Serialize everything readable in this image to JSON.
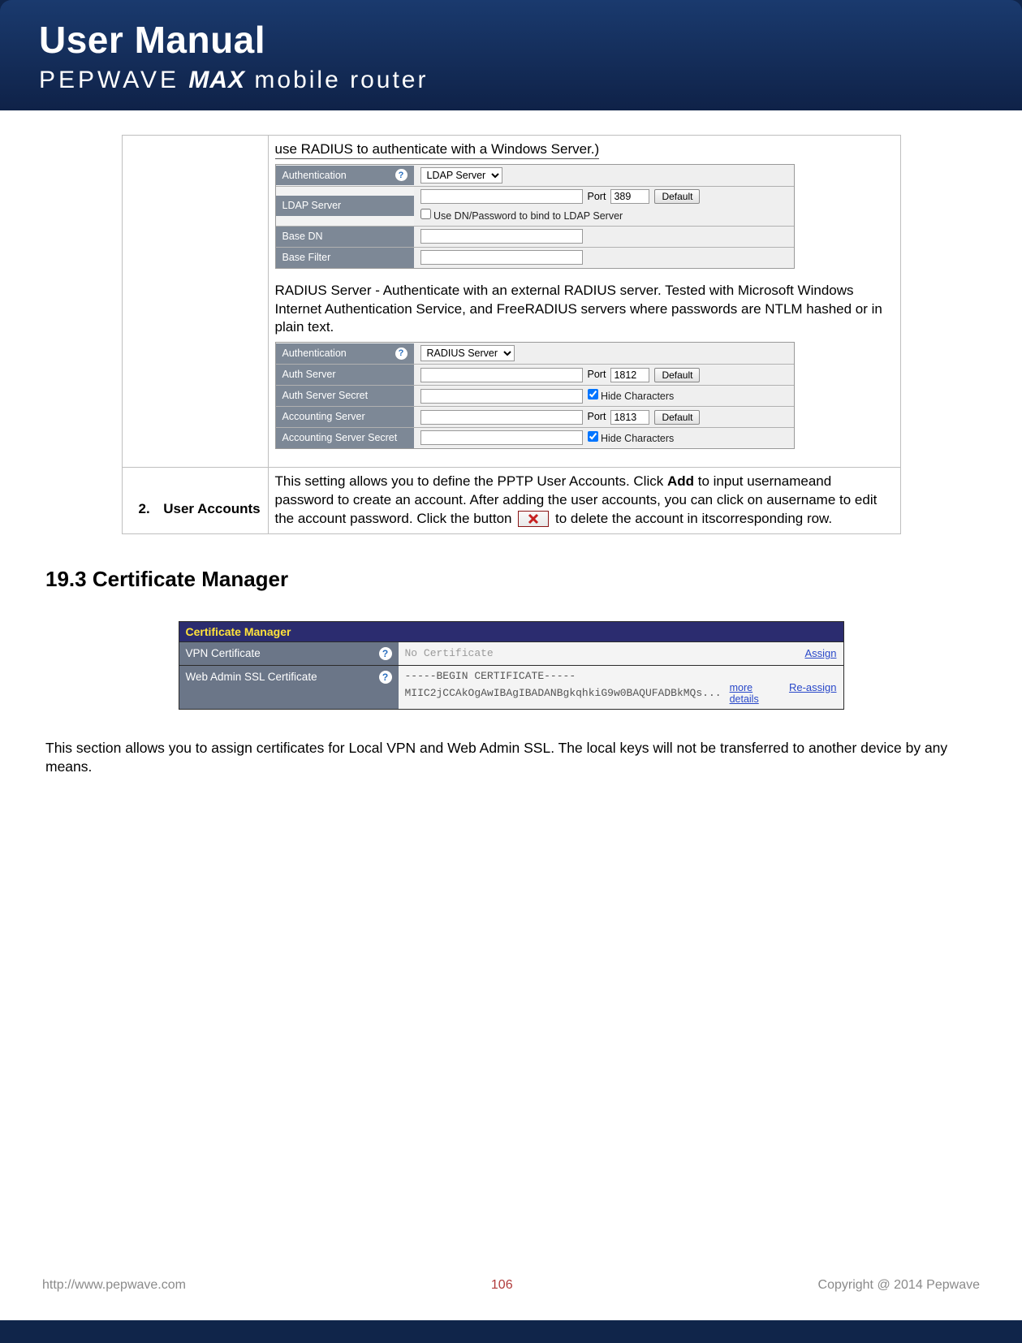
{
  "header": {
    "title": "User Manual",
    "brand": "PEPWAVE",
    "model": "MAX",
    "suffix": "mobile router"
  },
  "section1": {
    "intro_underlined": "use RADIUS to authenticate with a Windows Server.)",
    "ldap_panel": {
      "rows": {
        "auth": {
          "label": "Authentication",
          "select": "LDAP Server"
        },
        "ldap_server": {
          "label": "LDAP Server",
          "port_label": "Port",
          "port": "389",
          "default_btn": "Default",
          "checkbox": "Use DN/Password to bind to LDAP Server"
        },
        "base_dn": {
          "label": "Base DN"
        },
        "base_filter": {
          "label": "Base Filter"
        }
      }
    },
    "radius_intro": "RADIUS Server - Authenticate with an external RADIUS server. Tested with Microsoft Windows Internet Authentication Service, and FreeRADIUS servers where passwords are NTLM hashed or in plain text.",
    "radius_panel": {
      "rows": {
        "auth": {
          "label": "Authentication",
          "select": "RADIUS Server"
        },
        "auth_server": {
          "label": "Auth Server",
          "port_label": "Port",
          "port": "1812",
          "default_btn": "Default"
        },
        "auth_secret": {
          "label": "Auth Server Secret",
          "checkbox": "Hide Characters"
        },
        "acct_server": {
          "label": "Accounting Server",
          "port_label": "Port",
          "port": "1813",
          "default_btn": "Default"
        },
        "acct_secret": {
          "label": "Accounting Server Secret",
          "checkbox": "Hide Characters"
        }
      }
    }
  },
  "section2": {
    "num": "2.",
    "title": "User Accounts",
    "desc_part1": "This setting allows you to define the PPTP User Accounts. Click ",
    "desc_bold": "Add",
    "desc_part2": " to input usernameand password to create an account. After adding the user accounts, you can click on ausername to edit the account password. Click the button ",
    "desc_part3": " to delete the account in itscorresponding row."
  },
  "heading193": "19.3  Certificate Manager",
  "cert_panel": {
    "title": "Certificate Manager",
    "row1": {
      "label": "VPN Certificate",
      "value": "No Certificate",
      "link": "Assign"
    },
    "row2": {
      "label": "Web Admin SSL Certificate",
      "line1": "-----BEGIN CERTIFICATE-----",
      "line2": "MIIC2jCCAkOgAwIBAgIBADANBgkqhkiG9w0BAQUFADBkMQs...",
      "more": "more details",
      "link": "Re-assign"
    }
  },
  "body_para": "This section allows you to assign certificates for Local VPN and Web Admin SSL. The local keys will not be transferred to another device by any means.",
  "footer": {
    "url": "http://www.pepwave.com",
    "page": "106",
    "copyright": "Copyright @ 2014 Pepwave"
  }
}
